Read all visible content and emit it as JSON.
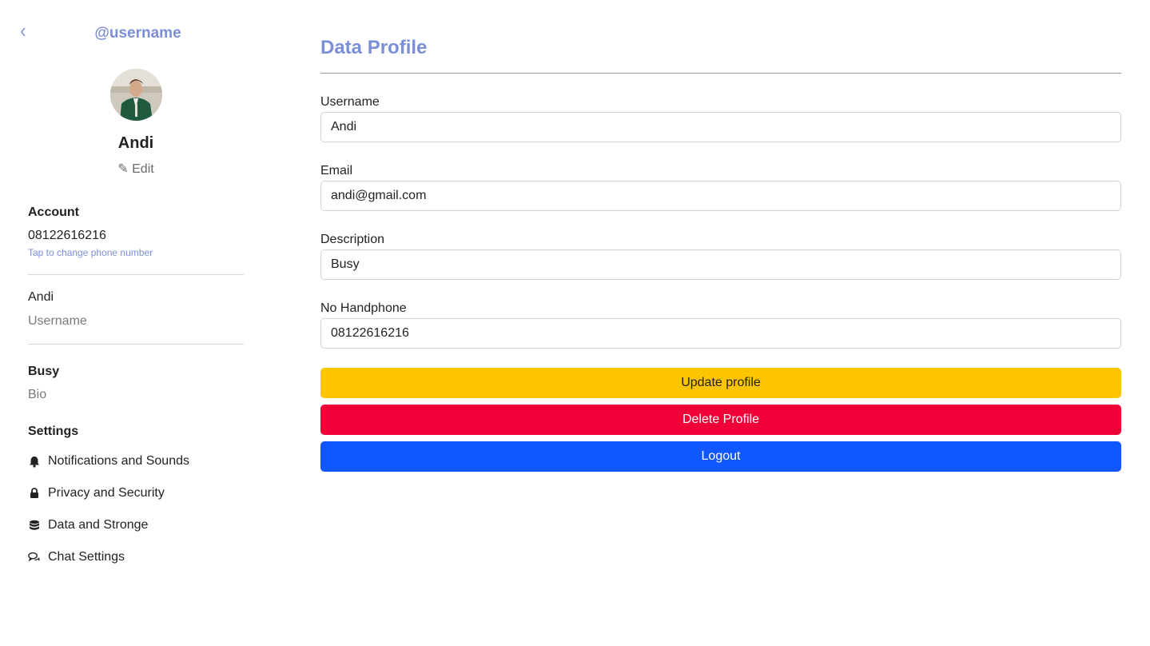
{
  "colors": {
    "accent": "#7b8fd9",
    "update_button": "#fcc500",
    "delete_button": "#ef0037",
    "logout_button": "#1157ff"
  },
  "sidebar": {
    "back_icon": "chevron-left-icon",
    "handle": "@username",
    "avatar_alt": "profile photo",
    "name": "Andi",
    "edit_label": "✎ Edit",
    "account": {
      "title": "Account",
      "phone": "08122616216",
      "phone_hint": "Tap to change phone number"
    },
    "username_block": {
      "value": "Andi",
      "caption": "Username"
    },
    "bio_block": {
      "value": "Busy",
      "caption": "Bio"
    },
    "settings": {
      "title": "Settings",
      "items": [
        {
          "label": "Notifications and Sounds",
          "icon": "bell-icon"
        },
        {
          "label": "Privacy and Security",
          "icon": "lock-icon"
        },
        {
          "label": "Data and Stronge",
          "icon": "database-icon"
        },
        {
          "label": "Chat Settings",
          "icon": "chat-icon"
        }
      ]
    }
  },
  "main": {
    "title": "Data Profile",
    "fields": [
      {
        "label": "Username",
        "value": "Andi"
      },
      {
        "label": "Email",
        "value": "andi@gmail.com"
      },
      {
        "label": "Description",
        "value": "Busy"
      },
      {
        "label": "No Handphone",
        "value": "08122616216"
      }
    ],
    "buttons": {
      "update": "Update profile",
      "delete": "Delete Profile",
      "logout": "Logout"
    }
  }
}
